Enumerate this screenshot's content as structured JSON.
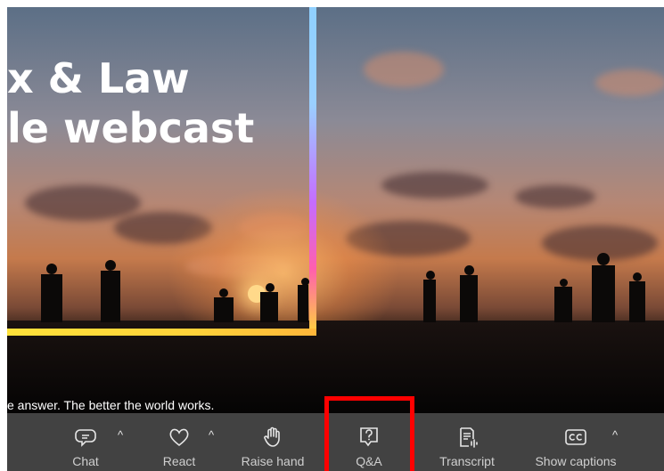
{
  "video": {
    "headline_line1": "x & Law",
    "headline_line2": "le webcast",
    "subtitle": "e answer. The better the world works."
  },
  "toolbar": {
    "items": [
      {
        "label": "Chat",
        "icon": "chat-icon",
        "has_caret": true
      },
      {
        "label": "React",
        "icon": "heart-icon",
        "has_caret": true
      },
      {
        "label": "Raise hand",
        "icon": "hand-icon",
        "has_caret": false
      },
      {
        "label": "Q&A",
        "icon": "question-bubble-icon",
        "has_caret": false
      },
      {
        "label": "Transcript",
        "icon": "transcript-icon",
        "has_caret": false
      },
      {
        "label": "Show captions",
        "icon": "cc-icon",
        "has_caret": true
      }
    ],
    "caret_glyph": "^"
  },
  "colors": {
    "toolbar_bg": "#424242",
    "highlight": "#ff0000",
    "frame_yellow": "#ffe13a",
    "frame_gradient_top": "#8fd0ff"
  }
}
